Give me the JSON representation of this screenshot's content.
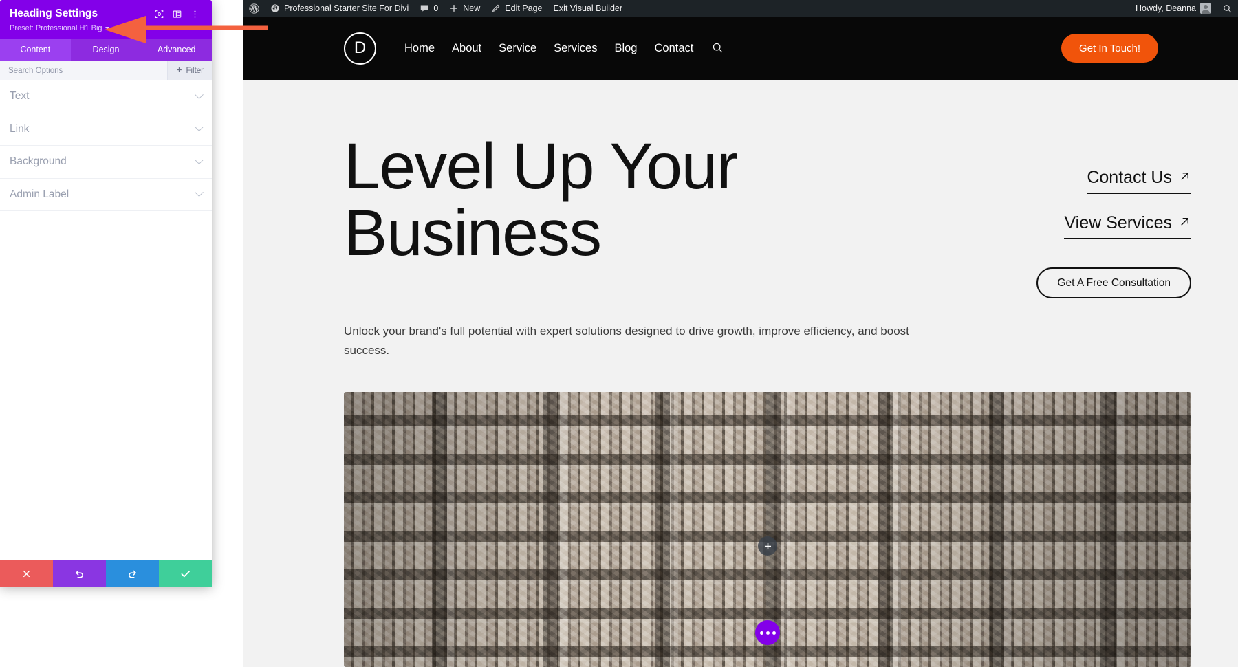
{
  "admin_bar": {
    "wp_logo_icon": "wordpress-logo-icon",
    "site_icon": "dashboard-site-icon",
    "site_name": "Professional Starter Site For Divi",
    "comments_icon": "comment-bubble-icon",
    "comments_count": "0",
    "new_icon": "plus-icon",
    "new_label": "New",
    "edit_icon": "pencil-icon",
    "edit_label": "Edit Page",
    "exit_label": "Exit Visual Builder",
    "howdy": "Howdy, Deanna",
    "avatar_icon": "user-avatar-icon",
    "search_icon": "search-icon"
  },
  "panel": {
    "title": "Heading Settings",
    "preset_label": "Preset: Professional H1 Big",
    "header_icons": [
      {
        "name": "focus-target-icon"
      },
      {
        "name": "panel-layout-icon"
      },
      {
        "name": "kebab-menu-icon"
      }
    ],
    "tabs": [
      {
        "label": "Content",
        "active": true
      },
      {
        "label": "Design",
        "active": false
      },
      {
        "label": "Advanced",
        "active": false
      }
    ],
    "search_placeholder": "Search Options",
    "search_value": "",
    "filter_label": "Filter",
    "filter_icon": "plus-icon",
    "sections": [
      {
        "label": "Text",
        "chevron": "chevron-down-icon"
      },
      {
        "label": "Link",
        "chevron": "chevron-down-icon"
      },
      {
        "label": "Background",
        "chevron": "chevron-down-icon"
      },
      {
        "label": "Admin Label",
        "chevron": "chevron-down-icon"
      }
    ],
    "footer": [
      {
        "name": "cancel-button",
        "icon": "close-x-icon",
        "color": "#eb5b5b"
      },
      {
        "name": "undo-button",
        "icon": "undo-arrow-icon",
        "color": "#8a36e2"
      },
      {
        "name": "redo-button",
        "icon": "redo-arrow-icon",
        "color": "#2a8fdd"
      },
      {
        "name": "save-button",
        "icon": "checkmark-icon",
        "color": "#3fcf9a"
      }
    ]
  },
  "annotation": {
    "name": "red-arrow-pointer",
    "color": "#f4613f",
    "points_to": "Preset: Professional H1 Big"
  },
  "site": {
    "logo_letter": "D",
    "nav": [
      {
        "label": "Home"
      },
      {
        "label": "About"
      },
      {
        "label": "Service"
      },
      {
        "label": "Services"
      },
      {
        "label": "Blog"
      },
      {
        "label": "Contact"
      }
    ],
    "nav_search_icon": "search-icon",
    "header_cta": "Get In Touch!",
    "header_cta_color": "#f1540b",
    "hero": {
      "heading": "Level Up Your\nBusiness",
      "links": [
        {
          "label": "Contact Us",
          "icon": "arrow-up-right-icon"
        },
        {
          "label": "View Services",
          "icon": "arrow-up-right-icon"
        }
      ],
      "outline_button": "Get A Free Consultation",
      "subtext": "Unlock your brand's full potential with expert solutions designed to drive growth, improve efficiency, and boost success."
    },
    "image_overlay": {
      "add_icon": "plus-icon",
      "more_icon": "ellipsis-icon",
      "more_color": "#8300e9"
    }
  }
}
